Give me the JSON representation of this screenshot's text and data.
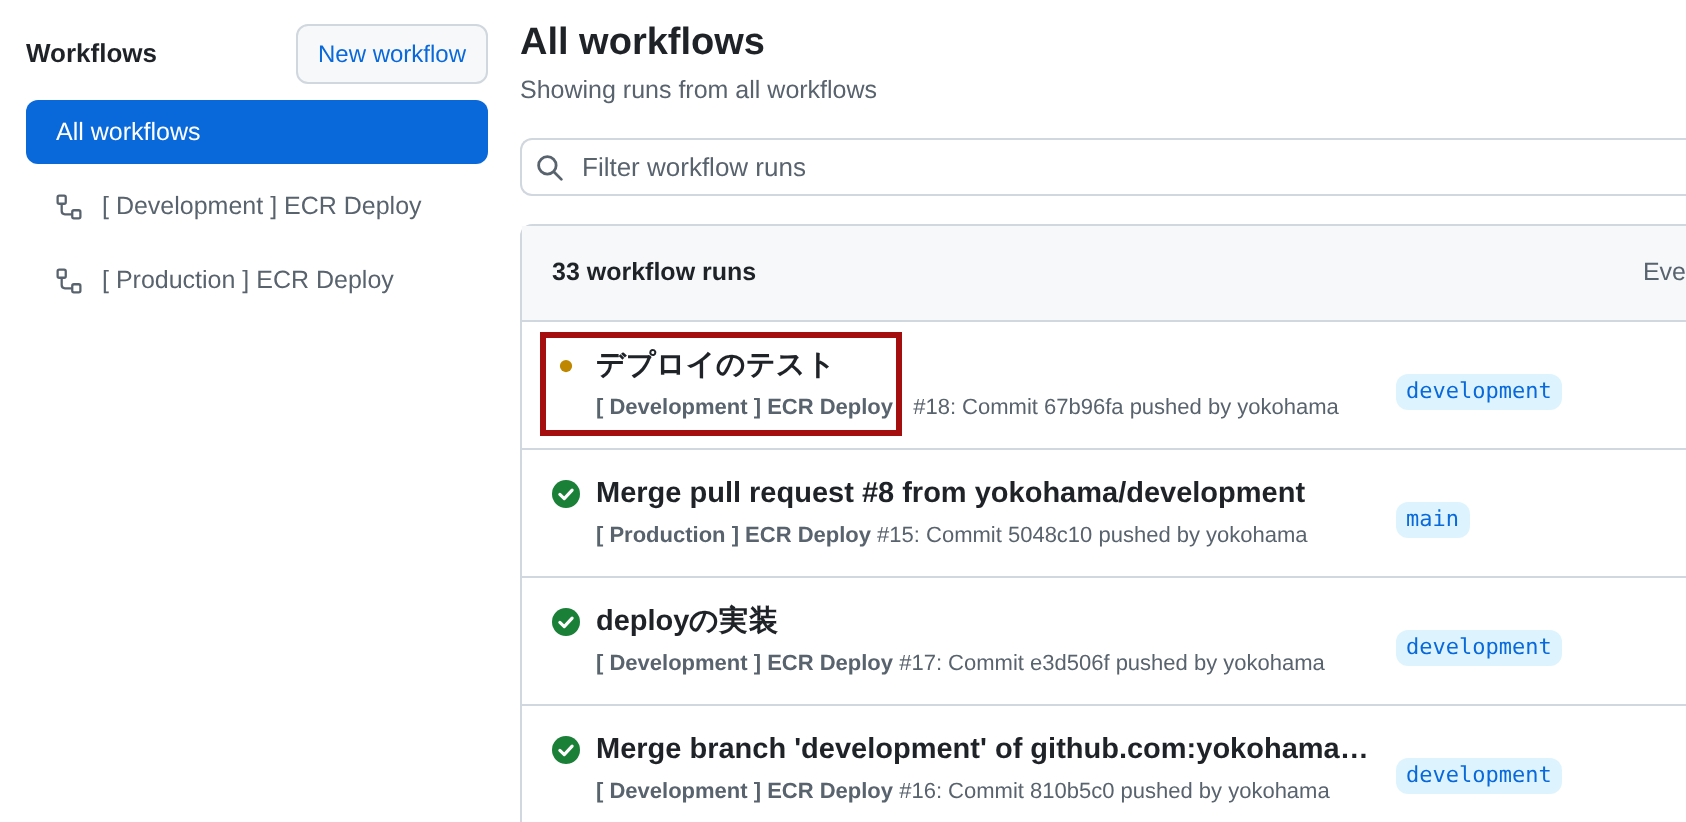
{
  "sidebar": {
    "title": "Workflows",
    "new_button": "New workflow",
    "items": [
      {
        "label": "All workflows",
        "selected": true,
        "icon": false
      },
      {
        "label": "[ Development ] ECR Deploy",
        "selected": false,
        "icon": true
      },
      {
        "label": "[ Production ] ECR Deploy",
        "selected": false,
        "icon": true
      }
    ]
  },
  "main": {
    "title": "All workflows",
    "subtitle": "Showing runs from all workflows",
    "filter": {
      "placeholder": "Filter workflow runs"
    },
    "runs_header": {
      "count": "33 workflow runs",
      "filter_1": "Eve"
    },
    "runs": [
      {
        "kind": "in_progress",
        "title": "デプロイのテスト",
        "workflow": "[ Development ] ECR Deploy",
        "detail": " #18: Commit 67b96fa pushed by yokohama",
        "branch": "development",
        "highlighted": true
      },
      {
        "kind": "success",
        "title": "Merge pull request #8 from yokohama/development",
        "workflow": "[ Production ] ECR Deploy",
        "detail": " #15: Commit 5048c10 pushed by yokohama",
        "branch": "main",
        "highlighted": false
      },
      {
        "kind": "success",
        "title": "deployの実装",
        "workflow": "[ Development ] ECR Deploy",
        "detail": " #17: Commit e3d506f pushed by yokohama",
        "branch": "development",
        "highlighted": false
      },
      {
        "kind": "success",
        "title": "Merge branch 'development' of github.com:yokohama…",
        "workflow": "[ Development ] ECR Deploy",
        "detail": " #16: Commit 810b5c0 pushed by yokohama",
        "branch": "development",
        "highlighted": false
      }
    ]
  }
}
